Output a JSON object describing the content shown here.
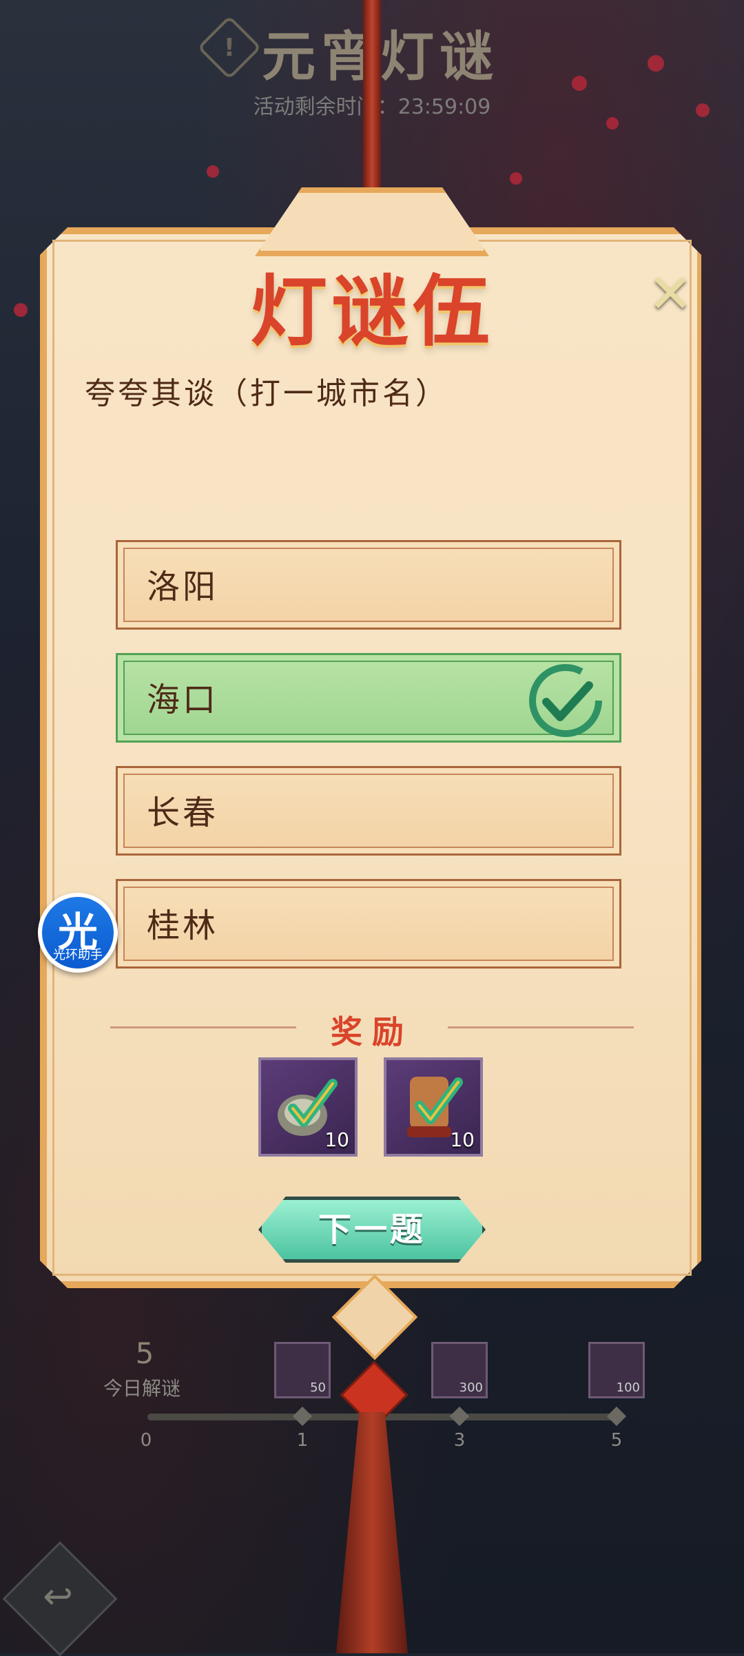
{
  "header": {
    "title": "元宵灯谜",
    "timer_text": "活动剩余时间：23:59:09"
  },
  "riddle": {
    "title": "灯谜伍",
    "question": "夸夸其谈（打一城市名）",
    "close_symbol": "✕"
  },
  "options": [
    {
      "label": "洛阳",
      "correct": false
    },
    {
      "label": "海口",
      "correct": true
    },
    {
      "label": "长春",
      "correct": false
    },
    {
      "label": "桂林",
      "correct": false
    }
  ],
  "rewards": {
    "title": "奖励",
    "items": [
      {
        "icon": "shield-reward-icon",
        "count": "10"
      },
      {
        "icon": "scroll-reward-icon",
        "count": "10"
      }
    ]
  },
  "next_button": {
    "label": "下一题"
  },
  "progress": {
    "solved_count": "5",
    "solved_label": "今日解谜",
    "milestones": [
      {
        "value": "0"
      },
      {
        "value": "1",
        "reward_count": "50"
      },
      {
        "value": "3",
        "reward_count": "300"
      },
      {
        "value": "5",
        "reward_count": "100"
      }
    ]
  },
  "assistant": {
    "glyph": "光",
    "label": "光环助手"
  },
  "colors": {
    "card_border": "#e6a85a",
    "title_red": "#d9442a",
    "correct_green": "#52a154",
    "button_teal": "#4cc3a0"
  }
}
